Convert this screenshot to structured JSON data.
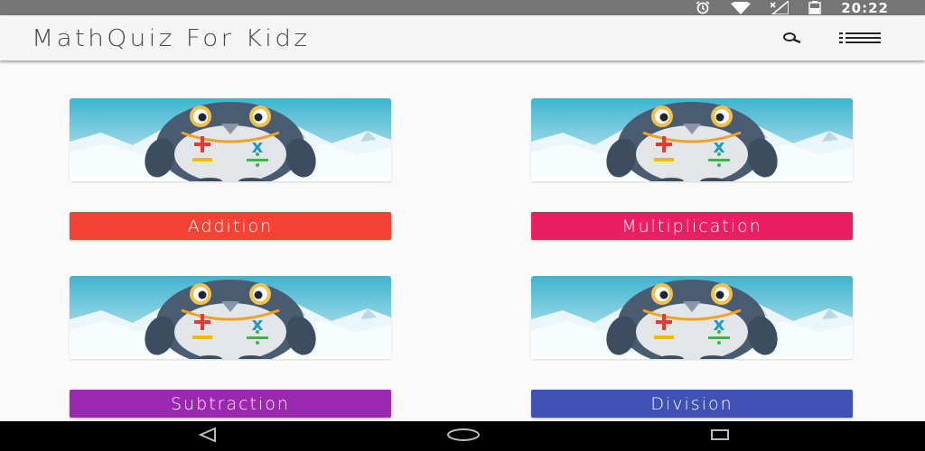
{
  "status_bar": {
    "time": "20:22",
    "icons": [
      "alarm-icon",
      "wifi-icon",
      "no-signal-icon",
      "battery-icon"
    ]
  },
  "app_bar": {
    "title": "MathQuiz For Kidz",
    "actions": [
      "search-icon",
      "menu-icon"
    ]
  },
  "cards": [
    {
      "label": "Addition",
      "color": "#f44336",
      "image": "penguin-illustration"
    },
    {
      "label": "Multiplication",
      "color": "#e91e63",
      "image": "penguin-illustration"
    },
    {
      "label": "Subtraction",
      "color": "#9c27b0",
      "image": "penguin-illustration"
    },
    {
      "label": "Division",
      "color": "#3f51b5",
      "image": "penguin-illustration"
    }
  ],
  "nav_bar": {
    "buttons": [
      "back-icon",
      "home-icon",
      "recents-icon"
    ]
  }
}
